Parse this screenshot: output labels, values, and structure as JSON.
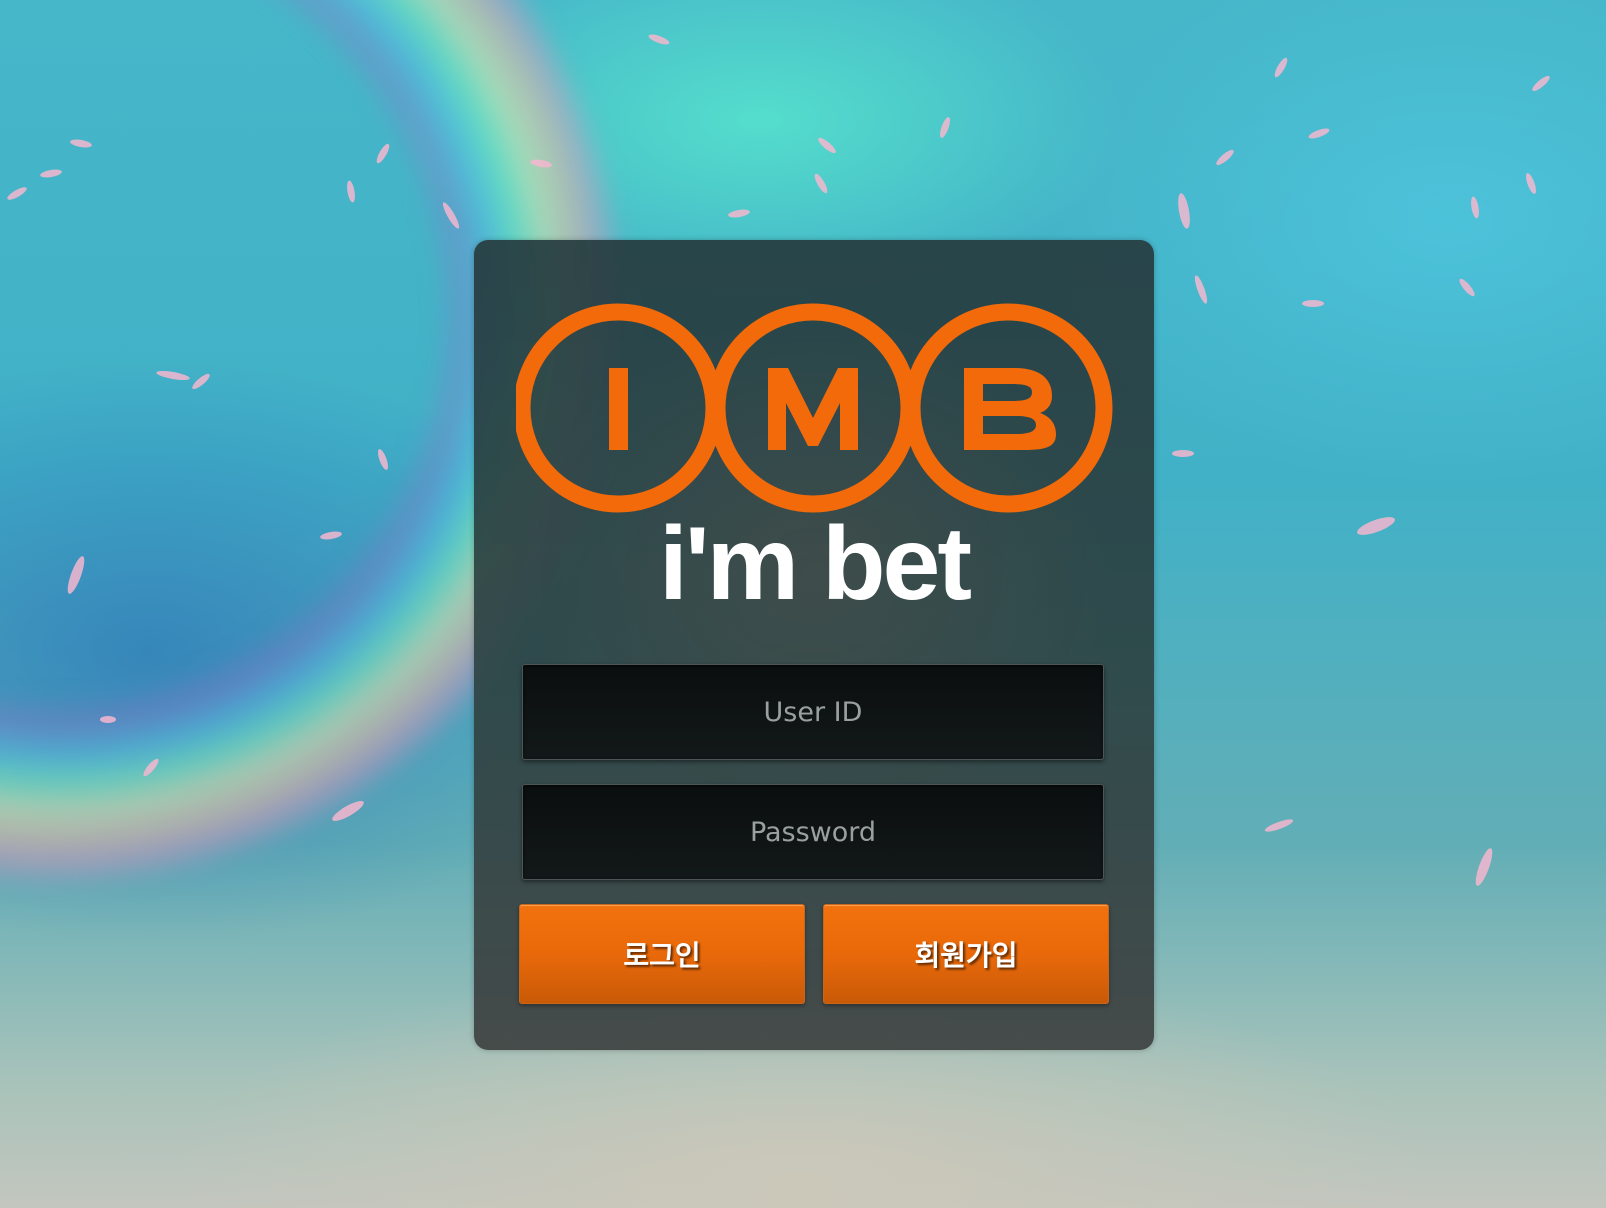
{
  "brand": {
    "logo_letters": [
      "I",
      "M",
      "B"
    ],
    "wordmark": "i'm bet",
    "accent_color": "#f26a0a"
  },
  "login_form": {
    "user_id": {
      "value": "",
      "placeholder": "User ID"
    },
    "password": {
      "value": "",
      "placeholder": "Password"
    },
    "login_button_label": "로그인",
    "signup_button_label": "회원가입"
  }
}
